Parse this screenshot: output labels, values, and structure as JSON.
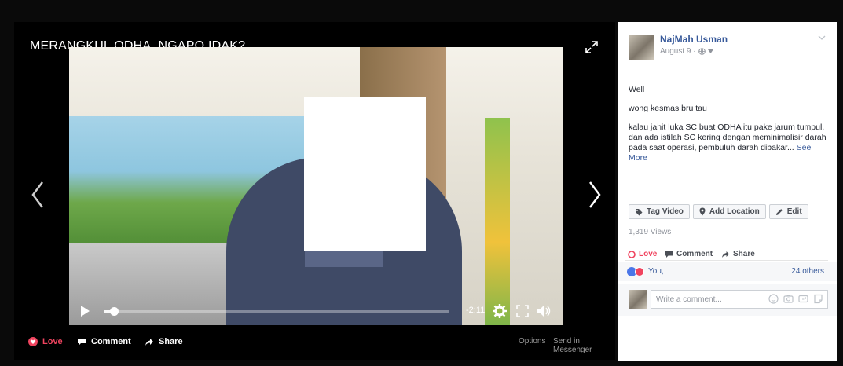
{
  "video": {
    "title": "MERANGKUL ODHA, NGAPO IDAK?",
    "time_remaining": "-2:11",
    "progress": 0.03
  },
  "video_actions": {
    "love": "Love",
    "comment": "Comment",
    "share": "Share",
    "options": "Options",
    "send_in_messenger": "Send in Messenger"
  },
  "post": {
    "author": "NajMah Usman",
    "date": "August 9 ·",
    "paragraphs": [
      "Well",
      "wong kesmas bru tau",
      "kalau jahit luka SC buat ODHA itu pake jarum tumpul, dan ada istilah SC kering dengan meminimalisir darah pada saat operasi, pembuluh darah dibakar..."
    ],
    "see_more": "See More",
    "tools": {
      "tag_video": "Tag Video",
      "add_location": "Add Location",
      "edit": "Edit"
    },
    "views": "1,319 Views",
    "reactions": {
      "love": "Love",
      "comment": "Comment",
      "share": "Share"
    },
    "likes": {
      "you": "You,",
      "others": "24 others"
    },
    "comment_placeholder": "Write a comment..."
  },
  "colors": {
    "love": "#f0445f",
    "link": "#365899",
    "like": "#4a76e8"
  },
  "icons": [
    "expand-icon",
    "chevron-left-icon",
    "chevron-right-icon",
    "play-icon",
    "gear-icon",
    "fullscreen-icon",
    "volume-icon",
    "love-icon",
    "comment-icon",
    "share-icon",
    "globe-icon",
    "tag-icon",
    "location-pin-icon",
    "pencil-icon",
    "emoji-icon",
    "camera-icon",
    "gif-icon",
    "sticker-icon"
  ]
}
